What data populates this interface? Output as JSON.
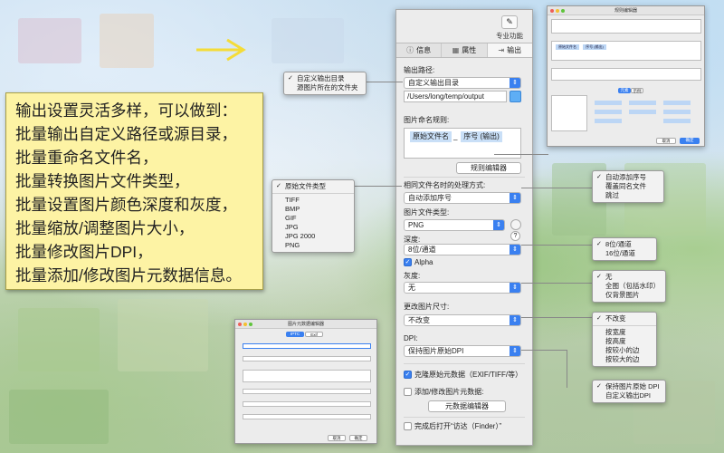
{
  "arrow": {
    "color": "#f4dc38"
  },
  "note": {
    "lines": [
      "输出设置灵活多样，可以做到：",
      "批量输出自定义路径或源目录，",
      "批量重命名文件名，",
      "批量转换图片文件类型，",
      "批量设置图片颜色深度和灰度，",
      "批量缩放/调整图片大小，",
      "批量修改图片DPI，",
      "批量添加/修改图片元数据信息。"
    ]
  },
  "panel": {
    "pro_label": "专业功能",
    "tabs": [
      {
        "label": "信息",
        "icon": "info-icon"
      },
      {
        "label": "属性",
        "icon": "grid-icon"
      },
      {
        "label": "输出",
        "icon": "export-icon"
      }
    ],
    "output_path_label": "输出路径:",
    "output_path_value": "自定义输出目录",
    "output_path_field": "/Users/long/temp/output",
    "naming_label": "图片命名规则:",
    "naming_tokens": [
      "原始文件名",
      "序号 (输出)"
    ],
    "naming_separator": "_",
    "rule_editor_button": "规则编辑器",
    "same_name_label": "相同文件名时的处理方式:",
    "same_name_value": "自动添加序号",
    "file_type_label": "图片文件类型:",
    "file_type_value": "PNG",
    "depth_label": "深度:",
    "depth_help": "?",
    "depth_value": "8位/通道",
    "alpha_label": "Alpha",
    "gray_label": "灰度:",
    "gray_value": "无",
    "resize_label": "更改图片尺寸:",
    "resize_value": "不改变",
    "dpi_label": "DPI:",
    "dpi_value": "保持图片原始DPI",
    "clone_meta_label": "克隆原始元数据（EXIF/TIFF/等）",
    "modify_meta_label": "添加/修改图片元数据:",
    "meta_editor_button": "元数据编辑器",
    "finder_label": "完成后打开“访达（Finder）”"
  },
  "menus": {
    "output": {
      "items": [
        "自定义输出目录",
        "源图片所在的文件夹"
      ],
      "checked": 0
    },
    "file_type": {
      "header": "原始文件类型",
      "items": [
        "TIFF",
        "BMP",
        "GIF",
        "JPG",
        "JPG 2000",
        "PNG"
      ]
    },
    "same_name": {
      "items": [
        "自动添加序号",
        "覆盖同名文件",
        "跳过"
      ],
      "checked": 0
    },
    "depth": {
      "items": [
        "8位/通道",
        "16位/通道"
      ],
      "checked": 0
    },
    "gray": {
      "items": [
        "无",
        "全图（包括水印）",
        "仅背景图片"
      ],
      "checked": 0
    },
    "resize": {
      "header": "不改变",
      "items": [
        "按宽度",
        "按高度",
        "按较小的边",
        "按较大的边"
      ]
    },
    "dpi": {
      "items": [
        "保持图片原始 DPI",
        "自定义输出DPI"
      ],
      "checked": 0
    }
  },
  "rule_editor_window": {
    "title": "规则编辑器",
    "field_token": "原始文件名",
    "field_token2": "序号 (输出)",
    "tab_labels": [
      "元素",
      "示例"
    ],
    "cancel": "取消",
    "ok": "确定"
  },
  "meta_window": {
    "title": "图片元数据编辑器",
    "tabs": [
      "IPTC",
      "Exif"
    ],
    "cancel": "取消",
    "ok": "确定"
  }
}
